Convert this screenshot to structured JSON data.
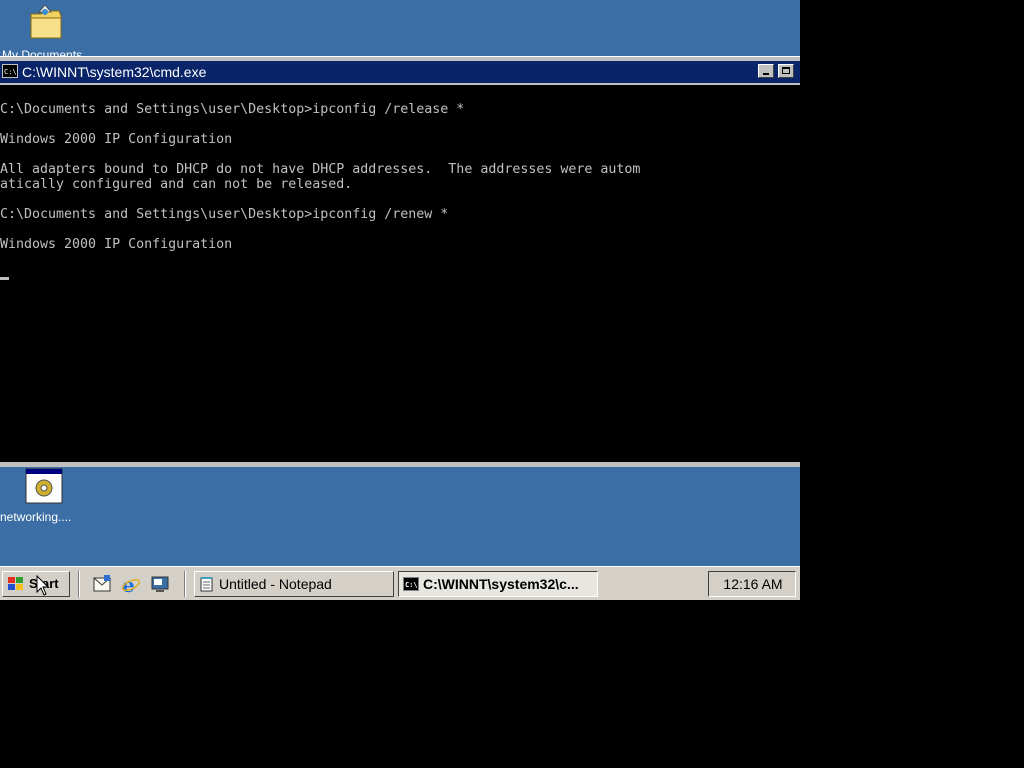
{
  "desktop": {
    "icons": [
      {
        "label": "My Documents",
        "icon": "folder-icon"
      },
      {
        "label": "networking....",
        "icon": "batch-file-icon"
      }
    ]
  },
  "cmd_window": {
    "title": "C:\\WINNT\\system32\\cmd.exe",
    "lines": [
      "C:\\Documents and Settings\\user\\Desktop>ipconfig /release *",
      "Windows 2000 IP Configuration",
      "All adapters bound to DHCP do not have DHCP addresses.  The addresses were autom",
      "atically configured and can not be released.",
      "C:\\Documents and Settings\\user\\Desktop>ipconfig /renew *",
      "Windows 2000 IP Configuration"
    ],
    "colors": {
      "title_bg": "#0a246a",
      "console_bg": "#000000",
      "console_text": "#c0c0c0"
    }
  },
  "taskbar": {
    "start_label": "Start",
    "quick_launch": [
      "outlook-express-icon",
      "internet-explorer-icon",
      "show-desktop-icon"
    ],
    "tasks": [
      {
        "label": "Untitled - Notepad",
        "icon": "notepad-icon",
        "active": false
      },
      {
        "label": "C:\\WINNT\\system32\\c...",
        "icon": "cmd-icon",
        "active": true
      }
    ],
    "clock": "12:16 AM"
  },
  "colors": {
    "desktop": "#3a6ea5",
    "taskbar": "#d4d0c8"
  }
}
